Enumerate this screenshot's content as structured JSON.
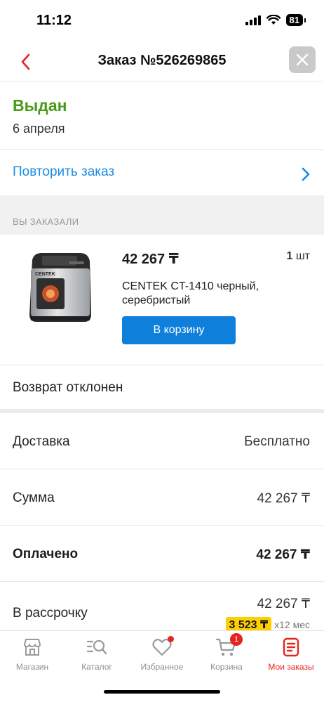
{
  "status_bar": {
    "time": "11:12",
    "battery": "81"
  },
  "header": {
    "title": "Заказ №526269865"
  },
  "order": {
    "status": "Выдан",
    "date": "6 апреля",
    "status_color": "#4a9a17"
  },
  "repeat": {
    "label": "Повторить заказ"
  },
  "section": {
    "ordered_label": "ВЫ ЗАКАЗАЛИ"
  },
  "product": {
    "price": "42 267 ₸",
    "qty_number": "1",
    "qty_unit": "шт",
    "name": "CENTEK CT-1410 черный, серебристый",
    "cart_button": "В корзину",
    "panel_text": "CENTEK"
  },
  "return_status": "Возврат отклонен",
  "summary": {
    "delivery_label": "Доставка",
    "delivery_value": "Бесплатно",
    "sum_label": "Сумма",
    "sum_value": "42 267 ₸",
    "paid_label": "Оплачено",
    "paid_value": "42 267 ₸"
  },
  "installment": {
    "label": "В рассрочку",
    "total": "42 267 ₸",
    "monthly": "3 523 ₸",
    "term": "x12 мес"
  },
  "tabs": [
    {
      "label": "Магазин"
    },
    {
      "label": "Каталог"
    },
    {
      "label": "Избранное"
    },
    {
      "label": "Корзина",
      "badge": "1"
    },
    {
      "label": "Мои заказы"
    }
  ],
  "colors": {
    "accent": "#e4241f",
    "link": "#1a8be0",
    "button": "#0f7fdc",
    "badge": "#ffd000"
  }
}
